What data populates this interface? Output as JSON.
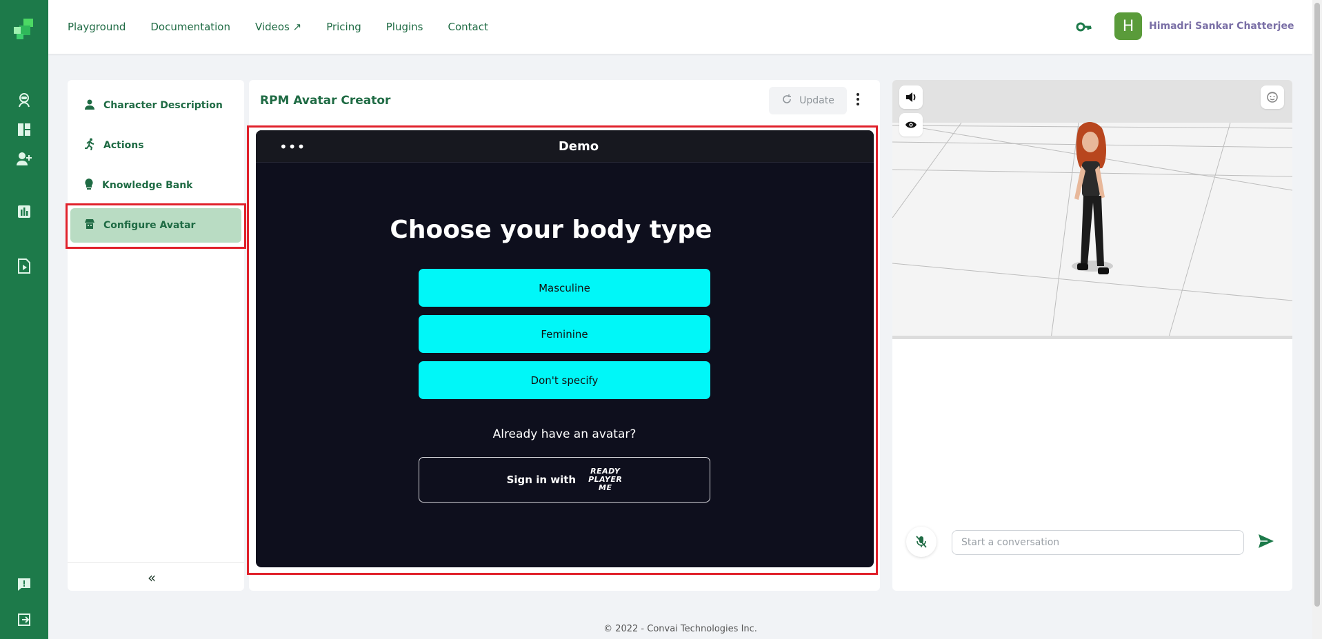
{
  "nav": {
    "items": [
      "Playground",
      "Documentation",
      "Videos ↗",
      "Pricing",
      "Plugins",
      "Contact"
    ]
  },
  "user": {
    "initial": "H",
    "name": "Himadri Sankar Chatterjee"
  },
  "sidebar": {
    "items": [
      {
        "label": "Character Description",
        "icon": "person-icon"
      },
      {
        "label": "Actions",
        "icon": "running-icon"
      },
      {
        "label": "Knowledge Bank",
        "icon": "lightbulb-icon"
      },
      {
        "label": "Configure Avatar",
        "icon": "avatar-config-icon",
        "active": true
      }
    ],
    "collapse_label": "«"
  },
  "main": {
    "title": "RPM Avatar Creator",
    "update_label": "Update",
    "demo": {
      "title": "Demo",
      "menu_label": "•••",
      "heading": "Choose your body type",
      "options": [
        "Masculine",
        "Feminine",
        "Don't specify"
      ],
      "already_text": "Already have an avatar?",
      "signin_label": "Sign in with",
      "rpm_logo": [
        "READY",
        "PLAYER",
        "ME"
      ]
    }
  },
  "chat": {
    "placeholder": "Start a conversation"
  },
  "footer": {
    "text": "© 2022 - Convai Technologies Inc."
  },
  "colors": {
    "brand": "#1d7a4a",
    "accent": "#00f7f8",
    "highlight": "#e0202a"
  }
}
